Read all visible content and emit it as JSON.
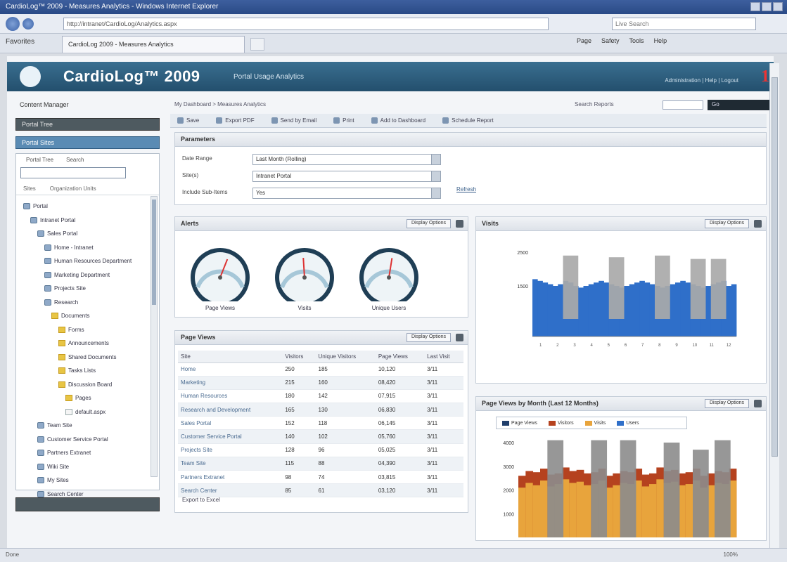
{
  "browser": {
    "window_title": "CardioLog™ 2009 - Measures Analytics - Windows Internet Explorer",
    "url": "http://intranet/CardioLog/Analytics.aspx",
    "search_placeholder": "Live Search",
    "favorites_label": "Favorites",
    "tab_title": "CardioLog 2009 - Measures Analytics",
    "commands": [
      "Page",
      "Safety",
      "Tools",
      "Help"
    ],
    "status_text": "Done",
    "zoom": "100%"
  },
  "app": {
    "title": "CardioLog™ 2009",
    "subtitle": "Portal Usage Analytics",
    "header_links": "Administration | Help | Logout",
    "badge": "1"
  },
  "sidebar": {
    "title": "Content Manager",
    "band_top": "Portal Tree",
    "band_selected": "Portal Sites",
    "tabs": [
      "Portal Tree",
      "Search"
    ],
    "search_value": "",
    "subtabs": [
      "Sites",
      "Organization Units"
    ],
    "tree": [
      {
        "label": "Portal",
        "icon": "node",
        "indent": 0
      },
      {
        "label": "Intranet Portal",
        "icon": "node",
        "indent": 1
      },
      {
        "label": "Sales Portal",
        "icon": "node",
        "indent": 2
      },
      {
        "label": "Home - Intranet",
        "icon": "node",
        "indent": 3
      },
      {
        "label": "Human Resources Department",
        "icon": "node",
        "indent": 3
      },
      {
        "label": "Marketing Department",
        "icon": "node",
        "indent": 3
      },
      {
        "label": "Projects Site",
        "icon": "node",
        "indent": 3
      },
      {
        "label": "Research",
        "icon": "node",
        "indent": 3
      },
      {
        "label": "Documents",
        "icon": "folder",
        "indent": 4
      },
      {
        "label": "Forms",
        "icon": "folder",
        "indent": 5
      },
      {
        "label": "Announcements",
        "icon": "folder",
        "indent": 5
      },
      {
        "label": "Shared Documents",
        "icon": "folder",
        "indent": 5
      },
      {
        "label": "Tasks Lists",
        "icon": "folder",
        "indent": 5
      },
      {
        "label": "Discussion Board",
        "icon": "folder",
        "indent": 5
      },
      {
        "label": "Pages",
        "icon": "folder",
        "indent": 6
      },
      {
        "label": "default.aspx",
        "icon": "doc",
        "indent": 6
      },
      {
        "label": "Team Site",
        "icon": "node",
        "indent": 2
      },
      {
        "label": "Customer Service Portal",
        "icon": "node",
        "indent": 2
      },
      {
        "label": "Partners Extranet",
        "icon": "node",
        "indent": 2
      },
      {
        "label": "Wiki Site",
        "icon": "node",
        "indent": 2
      },
      {
        "label": "My Sites",
        "icon": "node",
        "indent": 2
      },
      {
        "label": "Search Center",
        "icon": "node",
        "indent": 2
      }
    ]
  },
  "main": {
    "breadcrumb": "My Dashboard > Measures Analytics",
    "search_label": "Search Reports",
    "go_label": "Go",
    "toolbar": [
      "Save",
      "Export PDF",
      "Send by Email",
      "Print",
      "Add to Dashboard",
      "Schedule Report"
    ],
    "parameters": {
      "title": "Parameters",
      "rows": [
        {
          "label": "Date Range",
          "value": "Last Month (Rolling)"
        },
        {
          "label": "Site(s)",
          "value": "Intranet Portal"
        },
        {
          "label": "Include Sub-Items",
          "value": "Yes"
        }
      ],
      "refresh": "Refresh"
    },
    "gauges": {
      "title": "Alerts",
      "action": "Display Options",
      "items": [
        {
          "label": "Page Views",
          "value": 0.62
        },
        {
          "label": "Visits",
          "value": 0.48
        },
        {
          "label": "Unique Users",
          "value": 0.55
        }
      ]
    },
    "measures": {
      "title": "Page Views",
      "action": "Display Options",
      "columns": [
        "Site",
        "Visitors",
        "Unique Visitors",
        "Page Views",
        "Last Visit"
      ],
      "rows": [
        [
          "Home",
          "250",
          "185",
          "10,120",
          "3/11"
        ],
        [
          "Marketing",
          "215",
          "160",
          "08,420",
          "3/11"
        ],
        [
          "Human Resources",
          "180",
          "142",
          "07,915",
          "3/11"
        ],
        [
          "Research and Development",
          "165",
          "130",
          "06,830",
          "3/11"
        ],
        [
          "Sales Portal",
          "152",
          "118",
          "06,145",
          "3/11"
        ],
        [
          "Customer Service Portal",
          "140",
          "102",
          "05,760",
          "3/11"
        ],
        [
          "Projects Site",
          "128",
          "96",
          "05,025",
          "3/11"
        ],
        [
          "Team Site",
          "115",
          "88",
          "04,390",
          "3/11"
        ],
        [
          "Partners Extranet",
          "98",
          "74",
          "03,815",
          "3/11"
        ],
        [
          "Search Center",
          "85",
          "61",
          "03,120",
          "3/11"
        ]
      ],
      "export": "Export to Excel"
    },
    "visits_panel": {
      "title": "Visits",
      "action": "Display Options"
    },
    "pageviews_panel": {
      "title": "Page Views by Month (Last 12 Months)",
      "action": "Display Options",
      "legend": [
        "Page Views",
        "Visitors",
        "Visits",
        "Users"
      ]
    }
  },
  "colors": {
    "chart_blue": "#2f6fc9",
    "chart_gray": "#a9a9a9",
    "chart_orange": "#e8a43c",
    "chart_red": "#b5421f"
  },
  "chart_data": [
    {
      "type": "bar",
      "title": "Visits",
      "ylim": [
        0,
        2500
      ],
      "yticks": [
        "2500",
        "1500"
      ],
      "grid": false,
      "series": [
        {
          "values": [
            1700,
            1650,
            1600,
            1550,
            1500,
            1550,
            1650,
            1600,
            1500,
            1450,
            1500,
            1550,
            1600,
            1650,
            1600,
            1550,
            1500,
            1450,
            1500,
            1550,
            1600,
            1650,
            1600,
            1550,
            1500,
            1450,
            1500,
            1550,
            1600,
            1650,
            1600,
            1550,
            1500,
            1450,
            1500,
            1550,
            1600,
            1650,
            1500,
            1550
          ]
        },
        {
          "values": [
            0,
            0,
            0,
            0,
            0,
            0,
            0,
            0,
            0,
            0,
            0,
            0,
            0,
            0,
            0,
            0,
            0,
            0,
            0,
            0,
            0,
            0,
            0,
            0,
            0,
            0,
            0,
            0,
            0,
            0,
            0,
            0,
            0,
            0,
            0,
            0,
            0,
            0,
            0,
            0
          ]
        }
      ],
      "highlight_values": [
        2400,
        2350,
        2400,
        2300,
        2300
      ],
      "highlight_positions": [
        6,
        15,
        24,
        31,
        35
      ],
      "xticks": [
        "1",
        "2",
        "3",
        "4",
        "5",
        "6",
        "7",
        "8",
        "9",
        "10",
        "11",
        "12"
      ]
    },
    {
      "type": "bar",
      "title": "Page Views by Month (Last 12 Months)",
      "ylim": [
        0,
        4000
      ],
      "yticks": [
        "4000",
        "3000",
        "2000",
        "1000"
      ],
      "legend_position": "top",
      "series": [
        {
          "name": "Page Views",
          "values": [
            2600,
            2800,
            2750,
            2900,
            2650,
            2700,
            2950,
            2800,
            2850,
            2700,
            2750,
            2900,
            2600,
            2700,
            2800,
            2750,
            2900,
            2650,
            2700,
            2950,
            2800,
            2850,
            2700,
            2750,
            2900,
            2600,
            2700,
            2800,
            2750,
            2900
          ]
        },
        {
          "name": "Visits",
          "values": [
            2100,
            2300,
            2200,
            2400,
            2150,
            2250,
            2450,
            2300,
            2350,
            2200,
            2250,
            2400,
            2100,
            2200,
            2300,
            2250,
            2400,
            2150,
            2250,
            2450,
            2300,
            2350,
            2200,
            2250,
            2400,
            2100,
            2200,
            2300,
            2250,
            2400
          ]
        }
      ],
      "highlight_values": [
        4100,
        4100,
        4100,
        4000,
        3700,
        4100
      ],
      "highlight_positions": [
        4,
        10,
        14,
        20,
        24,
        27
      ]
    }
  ]
}
